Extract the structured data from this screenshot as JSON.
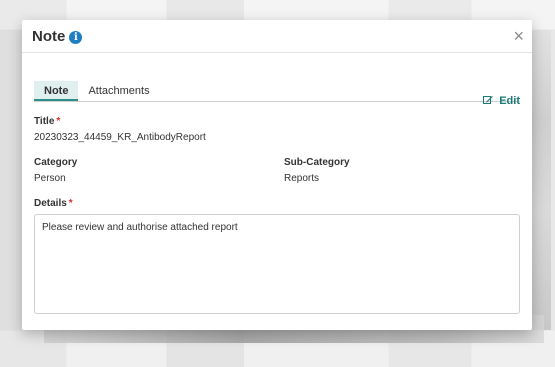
{
  "modal": {
    "title": "Note",
    "close_glyph": "×",
    "info_glyph": "i"
  },
  "toolbar": {
    "edit_label": "Edit",
    "edit_icon": "edit-icon"
  },
  "tabs": [
    {
      "label": "Note",
      "active": true
    },
    {
      "label": "Attachments",
      "active": false
    }
  ],
  "fields": {
    "title": {
      "label": "Title",
      "required": "*",
      "value": "20230323_44459_KR_AntibodyReport"
    },
    "category": {
      "label": "Category",
      "value": "Person"
    },
    "sub_category": {
      "label": "Sub-Category",
      "value": "Reports"
    },
    "details": {
      "label": "Details",
      "required": "*",
      "value": "Please review and authorise attached report"
    }
  },
  "colors": {
    "accent": "#2c8f8a",
    "info": "#1f7fc1",
    "required": "#d62b2b"
  }
}
